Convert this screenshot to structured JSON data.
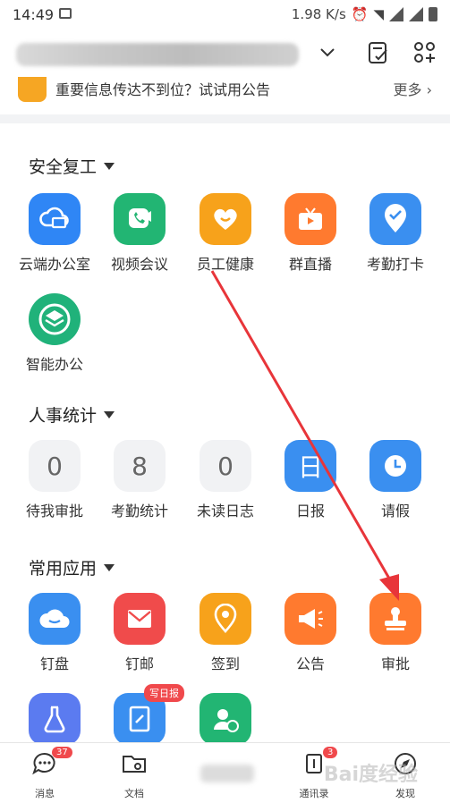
{
  "status_bar": {
    "time": "14:49",
    "network_speed": "1.98 K/s"
  },
  "announcement": {
    "text": "重要信息传达不到位？试试用公告",
    "more": "更多"
  },
  "sections": {
    "safe": {
      "title": "安全复工",
      "apps": [
        {
          "label": "云端办公室",
          "color": "#2f86f5",
          "icon": "cloud-office-icon"
        },
        {
          "label": "视频会议",
          "color": "#22b573",
          "icon": "video-call-icon"
        },
        {
          "label": "员工健康",
          "color": "#f7a21b",
          "icon": "heart-smile-icon"
        },
        {
          "label": "群直播",
          "color": "#ff7a2f",
          "icon": "tv-live-icon"
        },
        {
          "label": "考勤打卡",
          "color": "#3a8ff0",
          "icon": "location-check-icon"
        },
        {
          "label": "智能办公",
          "color": "#20b27a",
          "icon": "layers-icon"
        }
      ]
    },
    "hr": {
      "title": "人事统计",
      "apps": [
        {
          "value": "0",
          "label": "待我审批"
        },
        {
          "value": "8",
          "label": "考勤统计"
        },
        {
          "value": "0",
          "label": "未读日志"
        },
        {
          "label": "日报",
          "color": "#3a8ff0",
          "icon": "daily-report-icon",
          "glyph": "日"
        },
        {
          "label": "请假",
          "color": "#3a8ff0",
          "icon": "clock-icon"
        }
      ]
    },
    "common": {
      "title": "常用应用",
      "apps": [
        {
          "label": "钉盘",
          "color": "#3a8ff0",
          "icon": "cloud-drive-icon"
        },
        {
          "label": "钉邮",
          "color": "#f04b4b",
          "icon": "mail-icon"
        },
        {
          "label": "签到",
          "color": "#f7a21b",
          "icon": "checkin-pin-icon"
        },
        {
          "label": "公告",
          "color": "#ff7a2f",
          "icon": "megaphone-icon"
        },
        {
          "label": "审批",
          "color": "#ff7a2f",
          "icon": "stamp-icon"
        }
      ]
    },
    "extra": {
      "apps": [
        {
          "color": "#5b7bf0",
          "icon": "flask-icon"
        },
        {
          "color": "#3a8ff0",
          "icon": "notebook-icon",
          "badge": "写日报"
        },
        {
          "color": "#22b573",
          "icon": "contact-call-icon"
        }
      ]
    }
  },
  "tabbar": {
    "items": [
      {
        "label": "消息",
        "badge": "37"
      },
      {
        "label": "文档"
      },
      {
        "label": "通讯录",
        "badge": "3"
      },
      {
        "label": "发现"
      }
    ]
  },
  "watermark": "Bai度经验",
  "colors": {
    "arrow": "#e8353a",
    "divider": "#f2f3f5"
  }
}
